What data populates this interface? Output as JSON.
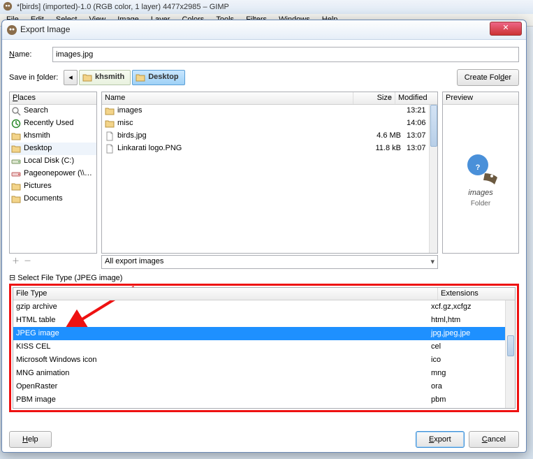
{
  "app": {
    "title": "*[birds] (imported)-1.0 (RGB color, 1 layer) 4477x2985 – GIMP",
    "menus": [
      "File",
      "Edit",
      "Select",
      "View",
      "Image",
      "Layer",
      "Colors",
      "Tools",
      "Filters",
      "Windows",
      "Help"
    ]
  },
  "dialog": {
    "title": "Export Image",
    "name_label": "Name:",
    "name_value": "images.jpg",
    "savein_label": "Save in folder:",
    "breadcrumbs": [
      {
        "label": "khsmith",
        "selected": false
      },
      {
        "label": "Desktop",
        "selected": true
      }
    ],
    "create_folder": "Create Folder",
    "places_header": "Places",
    "places": [
      {
        "label": "Search",
        "icon": "search"
      },
      {
        "label": "Recently Used",
        "icon": "recent"
      },
      {
        "label": "khsmith",
        "icon": "folder"
      },
      {
        "label": "Desktop",
        "icon": "folder",
        "selected": true
      },
      {
        "label": "Local Disk (C:)",
        "icon": "drive"
      },
      {
        "label": "Pageonepower (\\\\p1...",
        "icon": "netdrive"
      },
      {
        "label": "Pictures",
        "icon": "folder"
      },
      {
        "label": "Documents",
        "icon": "folder"
      }
    ],
    "file_headers": {
      "name": "Name",
      "size": "Size",
      "modified": "Modified"
    },
    "files": [
      {
        "name": "images",
        "type": "folder",
        "size": "",
        "modified": "13:21"
      },
      {
        "name": "misc",
        "type": "folder",
        "size": "",
        "modified": "14:06"
      },
      {
        "name": "birds.jpg",
        "type": "file",
        "size": "4.6 MB",
        "modified": "13:07"
      },
      {
        "name": "Linkarati logo.PNG",
        "type": "file",
        "size": "11.8 kB",
        "modified": "13:07"
      }
    ],
    "preview": {
      "header": "Preview",
      "name": "images",
      "type": "Folder"
    },
    "filter_label": "All export images",
    "expander_label": "Select File Type (JPEG image)",
    "type_headers": {
      "filetype": "File Type",
      "ext": "Extensions"
    },
    "types": [
      {
        "ft": "gzip archive",
        "ext": "xcf.gz,xcfgz"
      },
      {
        "ft": "HTML table",
        "ext": "html,htm"
      },
      {
        "ft": "JPEG image",
        "ext": "jpg,jpeg,jpe",
        "selected": true
      },
      {
        "ft": "KISS CEL",
        "ext": "cel"
      },
      {
        "ft": "Microsoft Windows icon",
        "ext": "ico"
      },
      {
        "ft": "MNG animation",
        "ext": "mng"
      },
      {
        "ft": "OpenRaster",
        "ext": "ora"
      },
      {
        "ft": "PBM image",
        "ext": "pbm"
      }
    ],
    "buttons": {
      "help": "Help",
      "export": "Export",
      "cancel": "Cancel"
    }
  }
}
